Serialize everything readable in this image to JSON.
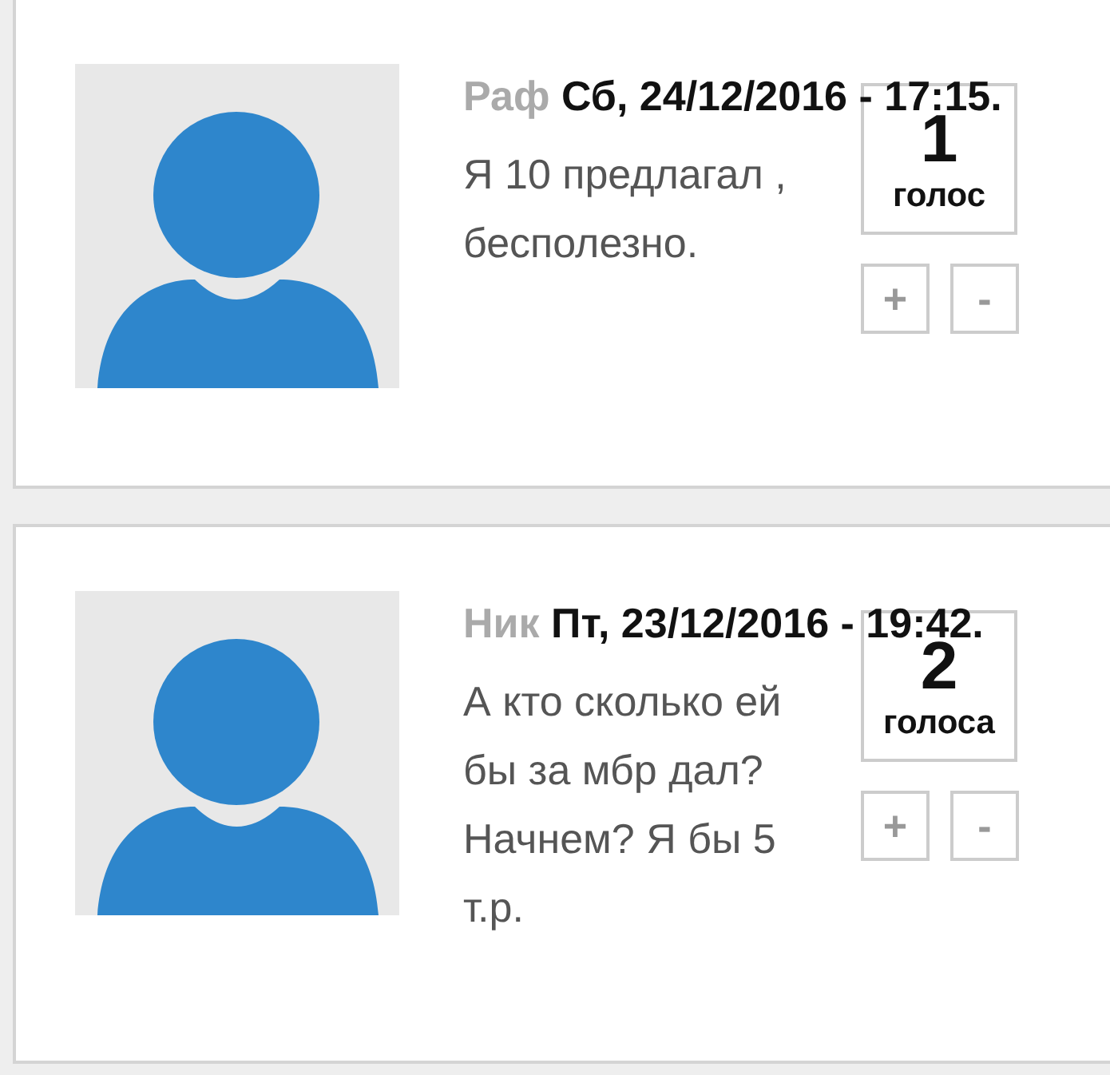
{
  "comments": [
    {
      "author": "Раф",
      "date": "Сб, 24/12/2016 - 17:15.",
      "text_lines": [
        "Я 10 предлагал ,",
        "бесполезно."
      ],
      "votes": "1",
      "votes_label": "голос",
      "plus": "+",
      "minus": "-"
    },
    {
      "author": "Ник",
      "date": "Пт, 23/12/2016 - 19:42.",
      "text_lines": [
        "А кто сколько ей",
        "бы за мбр дал?",
        "Начнем? Я бы 5",
        "т.р."
      ],
      "votes": "2",
      "votes_label": "голоса",
      "plus": "+",
      "minus": "-"
    }
  ]
}
